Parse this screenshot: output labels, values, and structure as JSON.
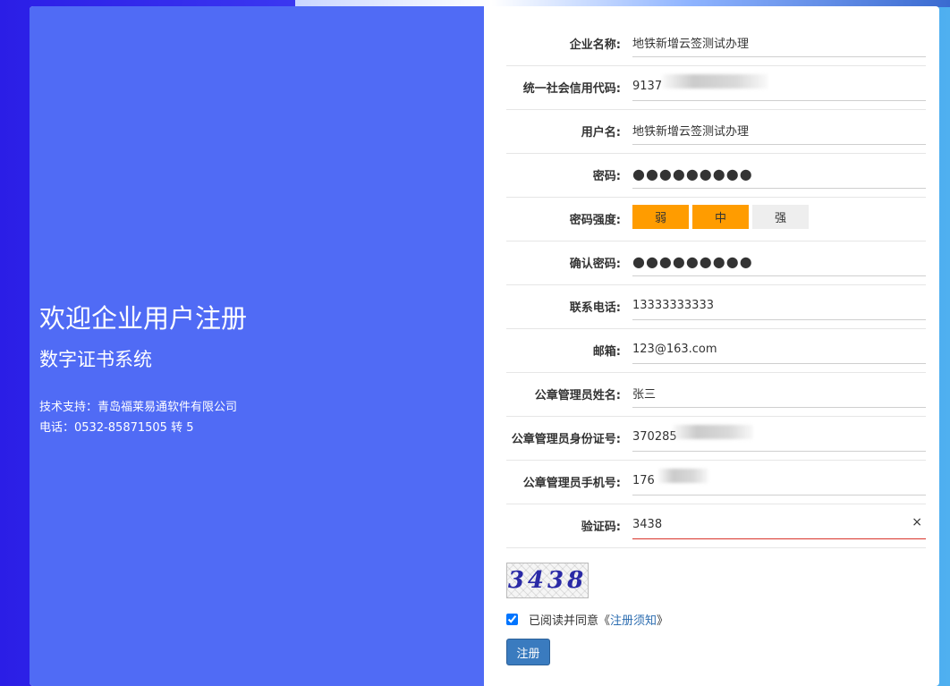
{
  "left_panel": {
    "welcome": "欢迎企业用户注册",
    "subtitle": "数字证书系统",
    "support": "技术支持：青岛福莱易通软件有限公司",
    "phone": "电话：0532-85871505 转 5"
  },
  "form": {
    "company_name": {
      "label": "企业名称:",
      "value": "地铁新增云签测试办理"
    },
    "credit_code": {
      "label": "统一社会信用代码:",
      "value": "9137"
    },
    "username": {
      "label": "用户名:",
      "value": "地铁新增云签测试办理"
    },
    "password": {
      "label": "密码:",
      "value": "●●●●●●●●●"
    },
    "strength": {
      "label": "密码强度:",
      "levels": [
        "弱",
        "中",
        "强"
      ],
      "active_count": 2
    },
    "confirm_password": {
      "label": "确认密码:",
      "value": "●●●●●●●●●"
    },
    "phone": {
      "label": "联系电话:",
      "value": "13333333333"
    },
    "email": {
      "label": "邮箱:",
      "value": "123@163.com"
    },
    "seal_admin_name": {
      "label": "公章管理员姓名:",
      "value": "张三"
    },
    "seal_admin_id": {
      "label": "公章管理员身份证号:",
      "value": "370285"
    },
    "seal_admin_mobile": {
      "label": "公章管理员手机号:",
      "value": "176"
    },
    "captcha": {
      "label": "验证码:",
      "value": "3438",
      "clear": "×"
    },
    "captcha_image_text": "3438",
    "agree_text": "已阅读并同意《",
    "agree_link": "注册须知",
    "agree_end": "》",
    "agree_checked": true,
    "submit": "注册"
  },
  "colors": {
    "left_panel": "#506bf5",
    "strength_on": "#ff9c00",
    "button": "#3a7bbf"
  }
}
